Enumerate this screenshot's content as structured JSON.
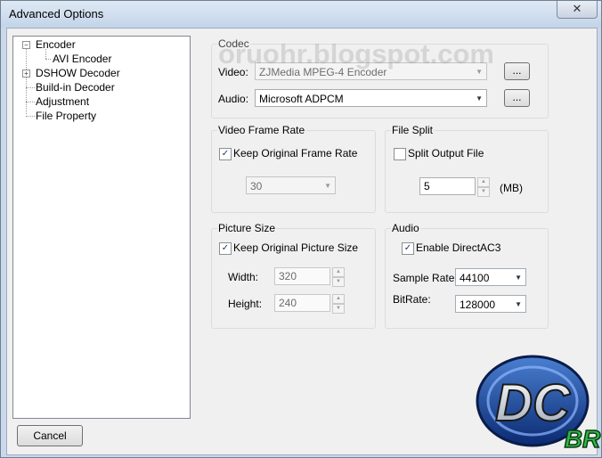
{
  "window": {
    "title": "Advanced Options",
    "close_glyph": "✕"
  },
  "tree": {
    "items": [
      {
        "label": "Encoder",
        "expander": "−"
      },
      {
        "label": "AVI Encoder"
      },
      {
        "label": "DSHOW Decoder",
        "expander": "+"
      },
      {
        "label": "Build-in Decoder"
      },
      {
        "label": "Adjustment"
      },
      {
        "label": "File Property"
      }
    ]
  },
  "codec": {
    "label": "Codec",
    "video_label": "Video:",
    "video_value": "ZJMedia MPEG-4 Encoder",
    "audio_label": "Audio:",
    "audio_value": "Microsoft ADPCM",
    "browse_label": "..."
  },
  "video_frame_rate": {
    "label": "Video Frame Rate",
    "keep_label": "Keep Original Frame Rate",
    "keep_checked": true,
    "rate_value": "30"
  },
  "file_split": {
    "label": "File Split",
    "split_label": "Split Output File",
    "split_checked": false,
    "size_value": "5",
    "unit": "(MB)"
  },
  "picture_size": {
    "label": "Picture Size",
    "keep_label": "Keep Original Picture Size",
    "keep_checked": true,
    "width_label": "Width:",
    "width_value": "320",
    "height_label": "Height:",
    "height_value": "240"
  },
  "audio": {
    "label": "Audio",
    "ac3_label": "Enable DirectAC3",
    "ac3_checked": true,
    "sample_rate_label": "Sample Rate:",
    "sample_rate_value": "44100",
    "bitrate_label": "BitRate:",
    "bitrate_value": "128000"
  },
  "footer": {
    "cancel_label": "Cancel"
  },
  "watermark": "oruohr.blogspot.com",
  "logo": {
    "text": "DC",
    "sub": "BR"
  },
  "check_glyph": "✓",
  "arrow_glyph": "▼"
}
